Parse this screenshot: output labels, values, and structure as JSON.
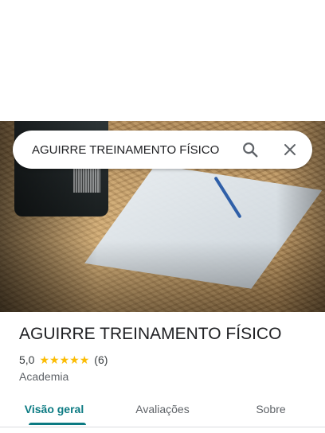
{
  "search": {
    "query": "AGUIRRE TREINAMENTO FÍSICO",
    "search_icon": "search-icon",
    "close_icon": "close-icon"
  },
  "place": {
    "name": "AGUIRRE TREINAMENTO FÍSICO",
    "rating": "5,0",
    "stars": 5,
    "review_count": "(6)",
    "category": "Academia"
  },
  "tabs": [
    {
      "label": "Visão geral",
      "active": true
    },
    {
      "label": "Avaliações",
      "active": false
    },
    {
      "label": "Sobre",
      "active": false
    }
  ],
  "colors": {
    "accent": "#0b7a82",
    "star": "#fbbc04"
  }
}
